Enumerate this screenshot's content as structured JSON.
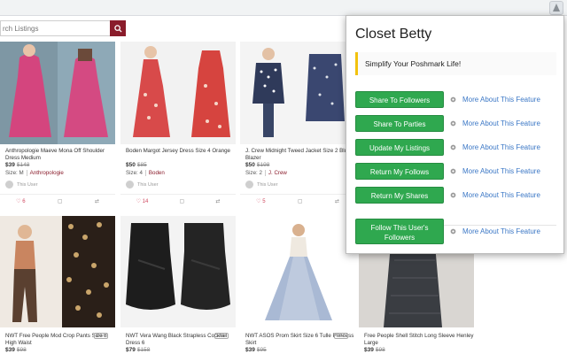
{
  "search": {
    "placeholder": "rch Listings"
  },
  "listings": [
    {
      "title": "Anthropologie Maeve Mona Off Shoulder Dress Medium",
      "price": "$39",
      "orig_price": "$148",
      "size": "Size: M",
      "brand": "Anthropologie",
      "user": "This User",
      "likes": "6"
    },
    {
      "title": "Boden Margot Jersey Dress Size 4 Orange",
      "price": "$50",
      "orig_price": "$85",
      "size": "Size: 4",
      "brand": "Boden",
      "user": "This User",
      "likes": "14"
    },
    {
      "title": "J. Crew Midnight Tweed Jacket Size 2 Blue Blazer",
      "price": "$50",
      "orig_price": "$198",
      "size": "Size: 2",
      "brand": "J. Crew",
      "user": "This User",
      "likes": "5"
    },
    {
      "title": "NWT Free People Mod Crop Pants Size 8 High Waist",
      "price": "$39",
      "orig_price": "$98",
      "tag": "NWT"
    },
    {
      "title": "NWT Vera Wang Black Strapless Cocktail Dress 6",
      "price": "$79",
      "orig_price": "$158",
      "tag": "NWT"
    },
    {
      "title": "NWT ASOS Prom Skirt Size 6 Tulle Princess Skirt",
      "price": "$39",
      "orig_price": "$95",
      "tag": "NWT"
    },
    {
      "title": "Free People Shell Stitch Long Sleeve Henley Large",
      "price": "$39",
      "orig_price": "$98"
    }
  ],
  "popup": {
    "title": "Closet Betty",
    "tagline": "Simplify Your Poshmark Life!",
    "buttons": [
      {
        "label": "Share To Followers",
        "more": "More About This Feature"
      },
      {
        "label": "Share To Parties",
        "more": "More About This Feature"
      },
      {
        "label": "Update My Listings",
        "more": "More About This Feature"
      },
      {
        "label": "Return My Follows",
        "more": "More About This Feature"
      },
      {
        "label": "Return My Shares",
        "more": "More About This Feature"
      },
      {
        "label": "Follow This User's Followers",
        "more": "More About This Feature"
      }
    ]
  },
  "colors": {
    "button_green": "#2fa84f",
    "link_blue": "#3c78c6",
    "brand_maroon": "#8a1c2b",
    "accent_yellow": "#f2c20d"
  },
  "icons": {
    "search": "search-icon",
    "gear": "gear-icon",
    "heart": "heart-icon",
    "share": "share-icon",
    "extension": "extension-icon"
  }
}
